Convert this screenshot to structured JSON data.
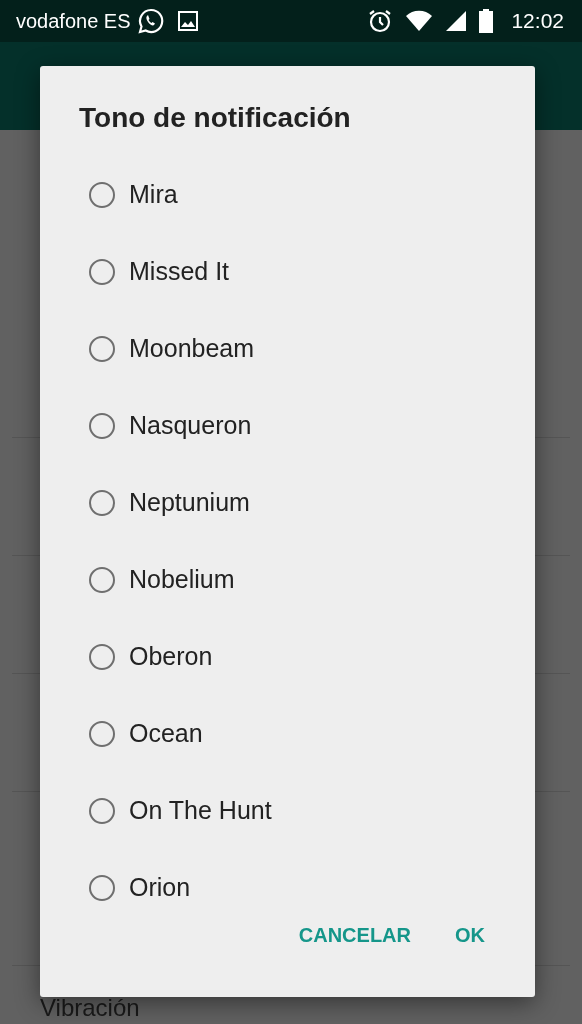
{
  "status_bar": {
    "carrier": "vodafone ES",
    "time": "12:02"
  },
  "background": {
    "visible_setting": "Vibración"
  },
  "dialog": {
    "title": "Tono de notificación",
    "options": [
      {
        "label": "Mira",
        "selected": false
      },
      {
        "label": "Missed It",
        "selected": false
      },
      {
        "label": "Moonbeam",
        "selected": false
      },
      {
        "label": "Nasqueron",
        "selected": false
      },
      {
        "label": "Neptunium",
        "selected": false
      },
      {
        "label": "Nobelium",
        "selected": false
      },
      {
        "label": "Oberon",
        "selected": false
      },
      {
        "label": "Ocean",
        "selected": false
      },
      {
        "label": "On The Hunt",
        "selected": false
      },
      {
        "label": "Orion",
        "selected": false
      }
    ],
    "buttons": [
      "CANCELAR",
      "OK"
    ]
  }
}
